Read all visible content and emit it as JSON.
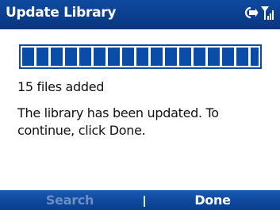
{
  "window": {
    "title": "Update Library"
  },
  "status_icons": [
    "connectivity-icon",
    "signal-icon"
  ],
  "progress": {
    "fraction": 1.0
  },
  "content": {
    "files_added": "15 files added",
    "message": "The library has been updated. To continue, click Done."
  },
  "softkeys": {
    "left_label": "Search",
    "right_label": "Done"
  },
  "colors": {
    "title_bar": "#0b3f8f",
    "accent": "#0a4da8",
    "disabled_softkey": "#6d8fbf"
  }
}
